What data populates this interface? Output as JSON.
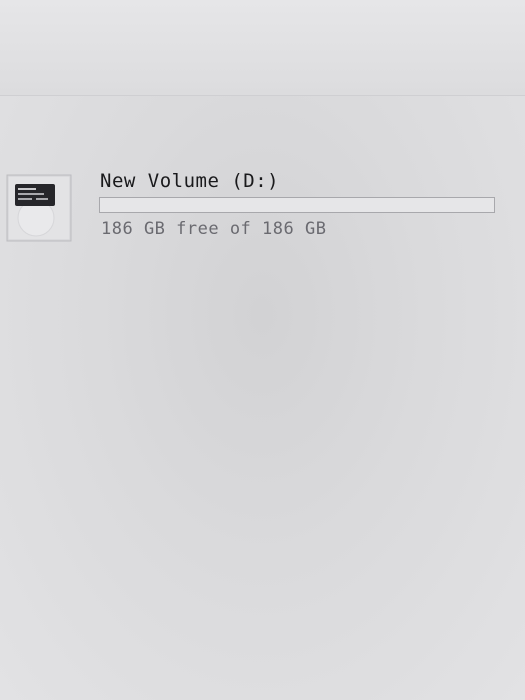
{
  "drive": {
    "name": "New Volume (D:)",
    "free_text": "186 GB free of 186 GB",
    "used_fraction": 0.0,
    "icon": "hard-drive-icon"
  },
  "colors": {
    "bar_fill": "#2a7fd4",
    "bar_track": "#e6e6e8",
    "name_text": "#1a1a1c",
    "free_text": "#6a6a70"
  }
}
